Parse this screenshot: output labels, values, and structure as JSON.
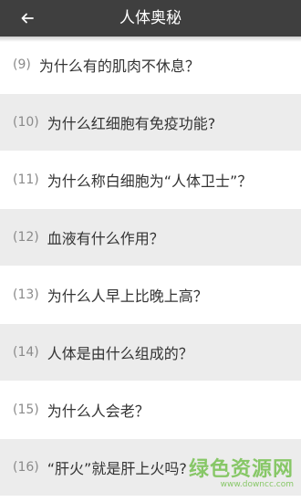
{
  "header": {
    "title": "人体奥秘",
    "back_icon": "back-arrow-icon"
  },
  "colors": {
    "app_bar": "#3f3f3f",
    "row_alt": "#ececec",
    "row": "#ffffff"
  },
  "items": [
    {
      "number": "(9)",
      "title": "为什么有的肌肉不休息？"
    },
    {
      "number": "(10)",
      "title": "为什么红细胞有免疫功能?"
    },
    {
      "number": "(11)",
      "title": "为什么称白细胞为“人体卫士”？"
    },
    {
      "number": "(12)",
      "title": "血液有什么作用？"
    },
    {
      "number": "(13)",
      "title": "为什么人早上比晚上高？"
    },
    {
      "number": "(14)",
      "title": "人体是由什么组成的？"
    },
    {
      "number": "(15)",
      "title": "为什么人会老？"
    },
    {
      "number": "(16)",
      "title": "“肝火”就是肝上火吗?"
    }
  ],
  "watermark": {
    "text": "绿色资源网",
    "url": "www.downcc.com"
  }
}
